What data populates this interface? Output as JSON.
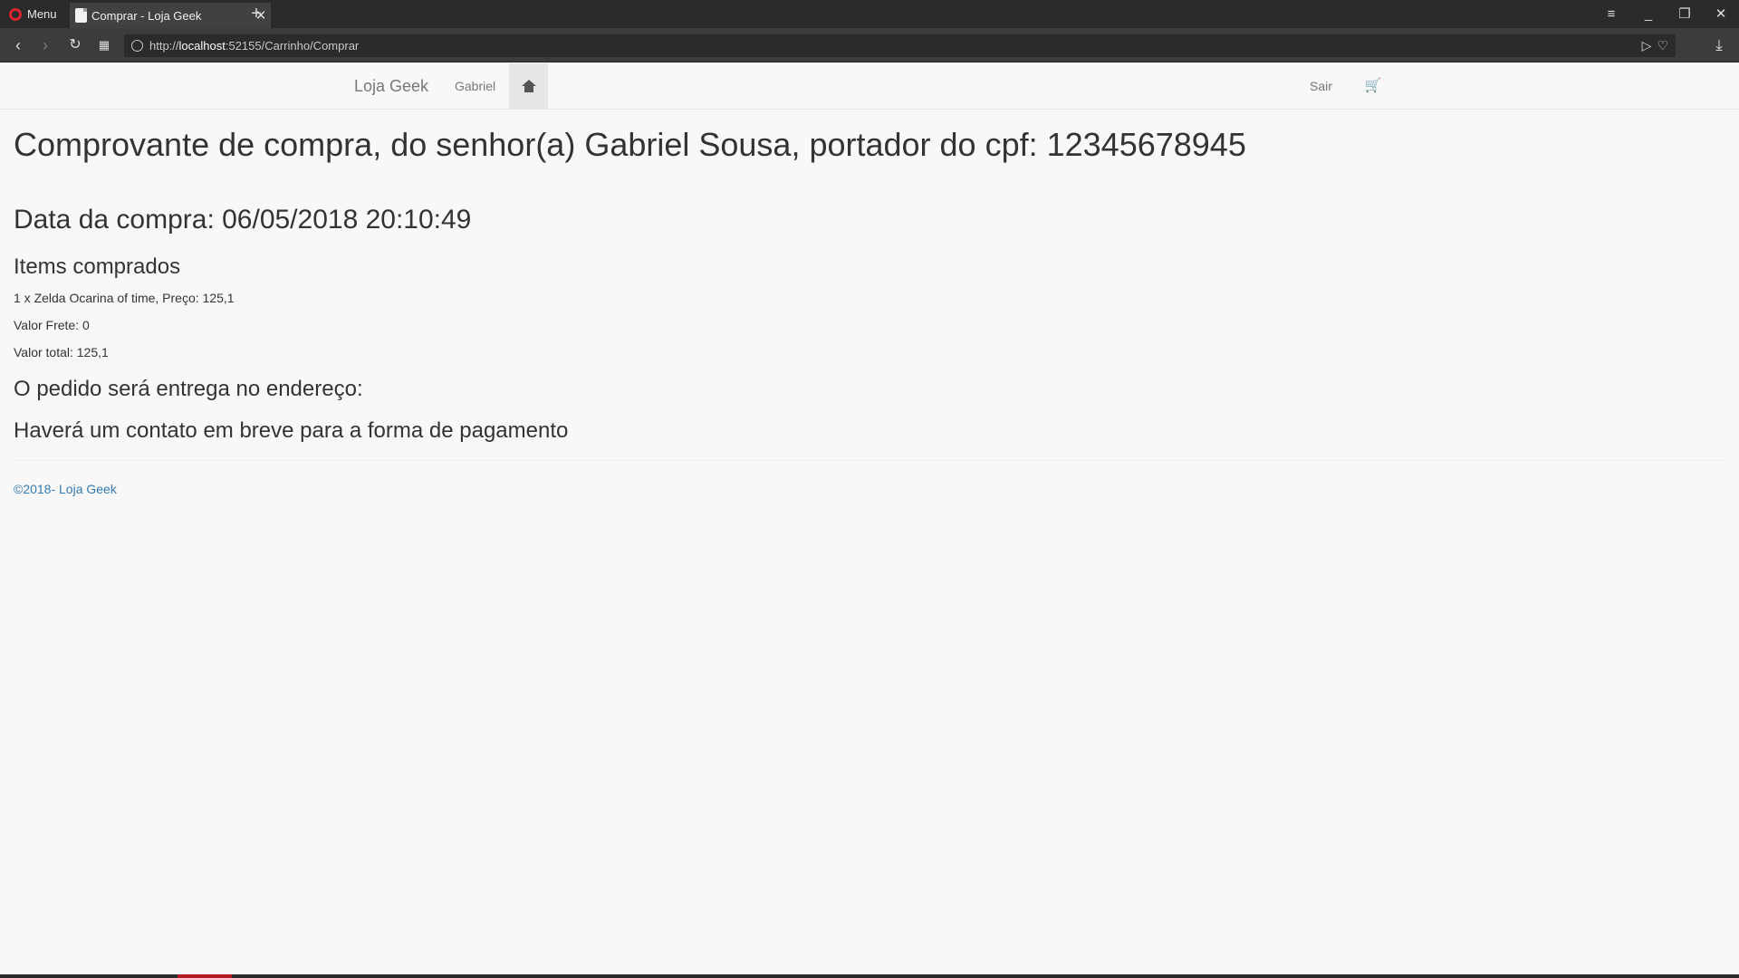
{
  "browser": {
    "menu_label": "Menu",
    "tab_title": "Comprar - Loja Geek",
    "url_prefix": "http://",
    "url_host": "localhost",
    "url_path": ":52155/Carrinho/Comprar"
  },
  "site_nav": {
    "brand": "Loja Geek",
    "user": "Gabriel",
    "logout": "Sair"
  },
  "receipt": {
    "title": "Comprovante de compra, do senhor(a) Gabriel Sousa, portador do cpf: 12345678945",
    "date": "Data da compra: 06/05/2018 20:10:49",
    "items_heading": "Items comprados",
    "items": [
      "1 x Zelda Ocarina of time, Preço: 125,1"
    ],
    "shipping": "Valor Frete: 0",
    "total": "Valor total: 125,1",
    "address": "O pedido será entrega no endereço:",
    "contact": "Haverá um contato em breve para a forma de pagamento"
  },
  "footer": {
    "text": "©2018- Loja Geek"
  },
  "colors": {
    "link": "#337ab7",
    "browser_dark": "#2b2b2b",
    "opera_red": "#d8252e"
  }
}
